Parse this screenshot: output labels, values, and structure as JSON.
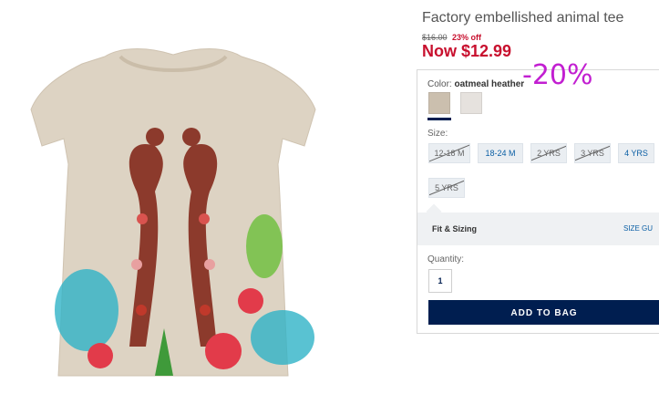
{
  "product": {
    "title": "Factory embellished animal tee",
    "was_price": "$16.00",
    "percent_off": "23% off",
    "now_price": "Now $12.99"
  },
  "discount_badge": "-20%",
  "color": {
    "label": "Color:",
    "selected": "oatmeal heather",
    "swatches": [
      {
        "name": "oatmeal heather",
        "hex": "#cbbfae",
        "selected": true
      },
      {
        "name": "light heather",
        "hex": "#e6e2de",
        "selected": false
      }
    ]
  },
  "size": {
    "label": "Size:",
    "options": [
      {
        "label": "12-18 M",
        "available": false
      },
      {
        "label": "18-24 M",
        "available": true
      },
      {
        "label": "2 YRS",
        "available": false
      },
      {
        "label": "3 YRS",
        "available": false
      },
      {
        "label": "4 YRS",
        "available": true
      },
      {
        "label": "5 YRS",
        "available": false
      }
    ]
  },
  "fit": {
    "label": "Fit & Sizing",
    "size_guide": "SIZE GU"
  },
  "quantity": {
    "label": "Quantity:",
    "value": "1"
  },
  "add_to_bag": "ADD TO BAG",
  "colors": {
    "sale_red": "#c8102e",
    "navy": "#001e50",
    "link_blue": "#0b5fa5",
    "badge_purple": "#c21fd1"
  }
}
